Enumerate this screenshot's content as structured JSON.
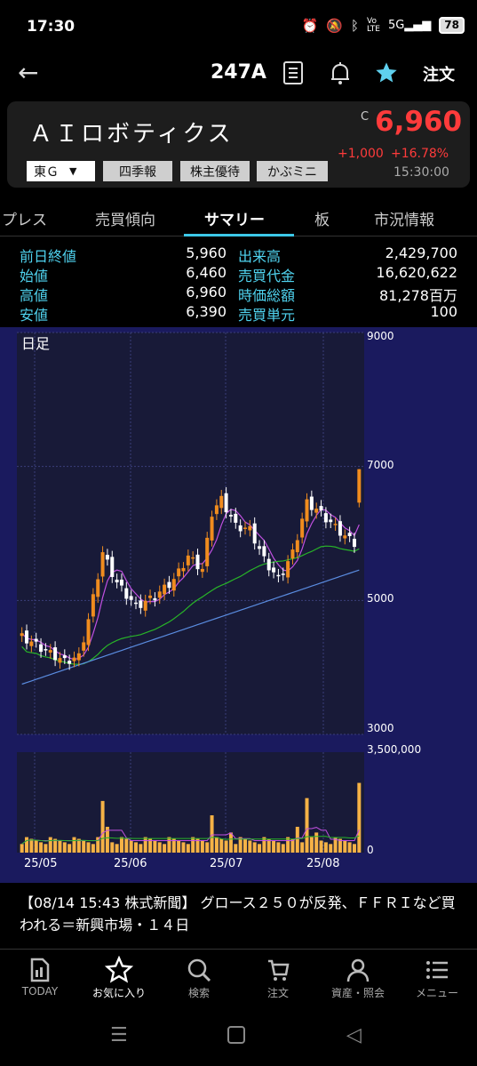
{
  "status": {
    "time": "17:30",
    "battery": "78"
  },
  "header": {
    "code": "247A",
    "order_label": "注文"
  },
  "stock": {
    "name": "ＡＩロボティクス",
    "price_mark": "C",
    "price": "6,960",
    "change": "+1,000",
    "change_pct": "+16.78%",
    "time": "15:30:00",
    "market": "東Ｇ",
    "tags": [
      "四季報",
      "株主優待",
      "かぶミニ"
    ]
  },
  "tabs": [
    "プレス",
    "売買傾向",
    "サマリー",
    "板",
    "市況情報"
  ],
  "summary": {
    "left": [
      {
        "label": "前日終値",
        "value": "5,960"
      },
      {
        "label": "始値",
        "value": "6,460"
      },
      {
        "label": "高値",
        "value": "6,960"
      },
      {
        "label": "安値",
        "value": "6,390"
      }
    ],
    "right": [
      {
        "label": "出来高",
        "value": "2,429,700"
      },
      {
        "label": "売買代金",
        "value": "16,620,622"
      },
      {
        "label": "時価総額",
        "value": "81,278百万"
      },
      {
        "label": "売買単元",
        "value": "100"
      }
    ]
  },
  "chart_data": {
    "type": "candlestick",
    "title": "日足",
    "price_ticks": [
      "9000",
      "7000",
      "5000",
      "3000"
    ],
    "ylim": [
      3000,
      9000
    ],
    "volume_ticks": [
      "3,500,000",
      "0"
    ],
    "volume_ylim": [
      0,
      3500000
    ],
    "x_ticks": [
      "25/05",
      "25/06",
      "25/07",
      "25/08"
    ],
    "colors": {
      "up": "#f08c1e",
      "down": "#ffffff",
      "ma_short": "#c050e0",
      "ma_mid": "#28b428",
      "ma_long": "#5a8ce0",
      "volume": "#f5b246"
    },
    "last": {
      "open": 6460,
      "high": 6960,
      "low": 6390,
      "close": 6960,
      "volume": 2429700
    }
  },
  "news": {
    "text": "【08/14 15:43 株式新聞】 グロース２５０が反発、ＦＦＲＩなど買われる＝新興市場・１４日"
  },
  "nav": [
    "TODAY",
    "お気に入り",
    "検索",
    "注文",
    "資産・照会",
    "メニュー"
  ]
}
